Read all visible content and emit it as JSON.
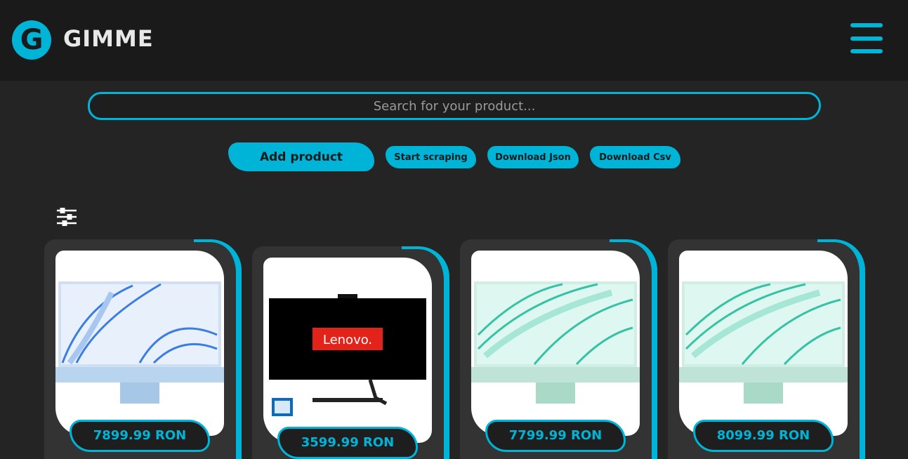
{
  "header": {
    "logo_letter": "G",
    "app_name": "GIMME"
  },
  "search": {
    "placeholder": "Search for your product..."
  },
  "toolbar": {
    "add_product": "Add product",
    "start_scraping": "Start scraping",
    "download_json": "Download Json",
    "download_csv": "Download Csv"
  },
  "products": [
    {
      "price": "7899.99 RON",
      "image": "imac-blue"
    },
    {
      "price": "3599.99 RON",
      "image": "lenovo-all-in-one"
    },
    {
      "price": "7799.99 RON",
      "image": "imac-green"
    },
    {
      "price": "8099.99 RON",
      "image": "imac-green"
    }
  ],
  "lenovo_brand": "Lenovo",
  "colors": {
    "accent": "#00b4d8",
    "header_bg": "#1a1a1a",
    "page_bg": "#242424",
    "card_bg": "#333333"
  }
}
